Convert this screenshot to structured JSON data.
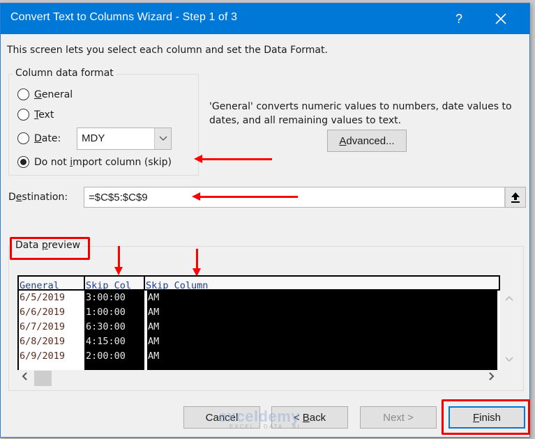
{
  "window": {
    "title": "Convert Text to Columns Wizard - Step 1 of 3",
    "help_label": "?",
    "close_label": "✕"
  },
  "intro_text": "This screen lets you select each column and set the Data Format.",
  "column_format": {
    "legend": "Column data format",
    "options": [
      {
        "accel": "G",
        "rest": "eneral",
        "selected": false
      },
      {
        "accel": "T",
        "rest": "ext",
        "selected": false
      },
      {
        "accel": "D",
        "rest": "ate:",
        "selected": false
      },
      {
        "pre": "Do not ",
        "accel": "i",
        "rest": "mport column (skip)",
        "selected": true
      }
    ],
    "date_format_value": "MDY",
    "date_dropdown_icon": "chevron-down-icon"
  },
  "description": "'General' converts numeric values to numbers, date values to dates, and all remaining values to text.",
  "advanced_button": {
    "accel": "A",
    "rest": "dvanced..."
  },
  "destination": {
    "label_pre": "D",
    "label_accel": "e",
    "label_rest": "stination:",
    "value": "=$C$5:$C$9",
    "collapse_icon": "collapse-dialog-icon"
  },
  "preview": {
    "legend_pre": "Data ",
    "legend_accel": "p",
    "legend_rest": "review",
    "headers": [
      "General",
      "Skip Col",
      "Skip Column"
    ],
    "rows": [
      [
        "6/5/2019",
        "3:00:00",
        "AM"
      ],
      [
        "6/6/2019",
        "1:00:00",
        "AM"
      ],
      [
        "6/7/2019",
        "6:30:00",
        "AM"
      ],
      [
        "6/8/2019",
        "4:15:00",
        "AM"
      ],
      [
        "6/9/2019",
        "2:00:00",
        "AM"
      ]
    ],
    "scroll_up": "^",
    "scroll_down": "v",
    "scroll_left": "<",
    "scroll_right": ">"
  },
  "buttons": {
    "cancel": "Cancel",
    "back_pre": "< ",
    "back_accel": "B",
    "back_rest": "ack",
    "next": "Next >",
    "finish_accel": "F",
    "finish_rest": "inish"
  },
  "watermark": {
    "main": "exceldemy",
    "sub": "EXCEL · DATA · BI"
  },
  "annotation_color": "#ff0000",
  "accent_color": "#0078d7"
}
